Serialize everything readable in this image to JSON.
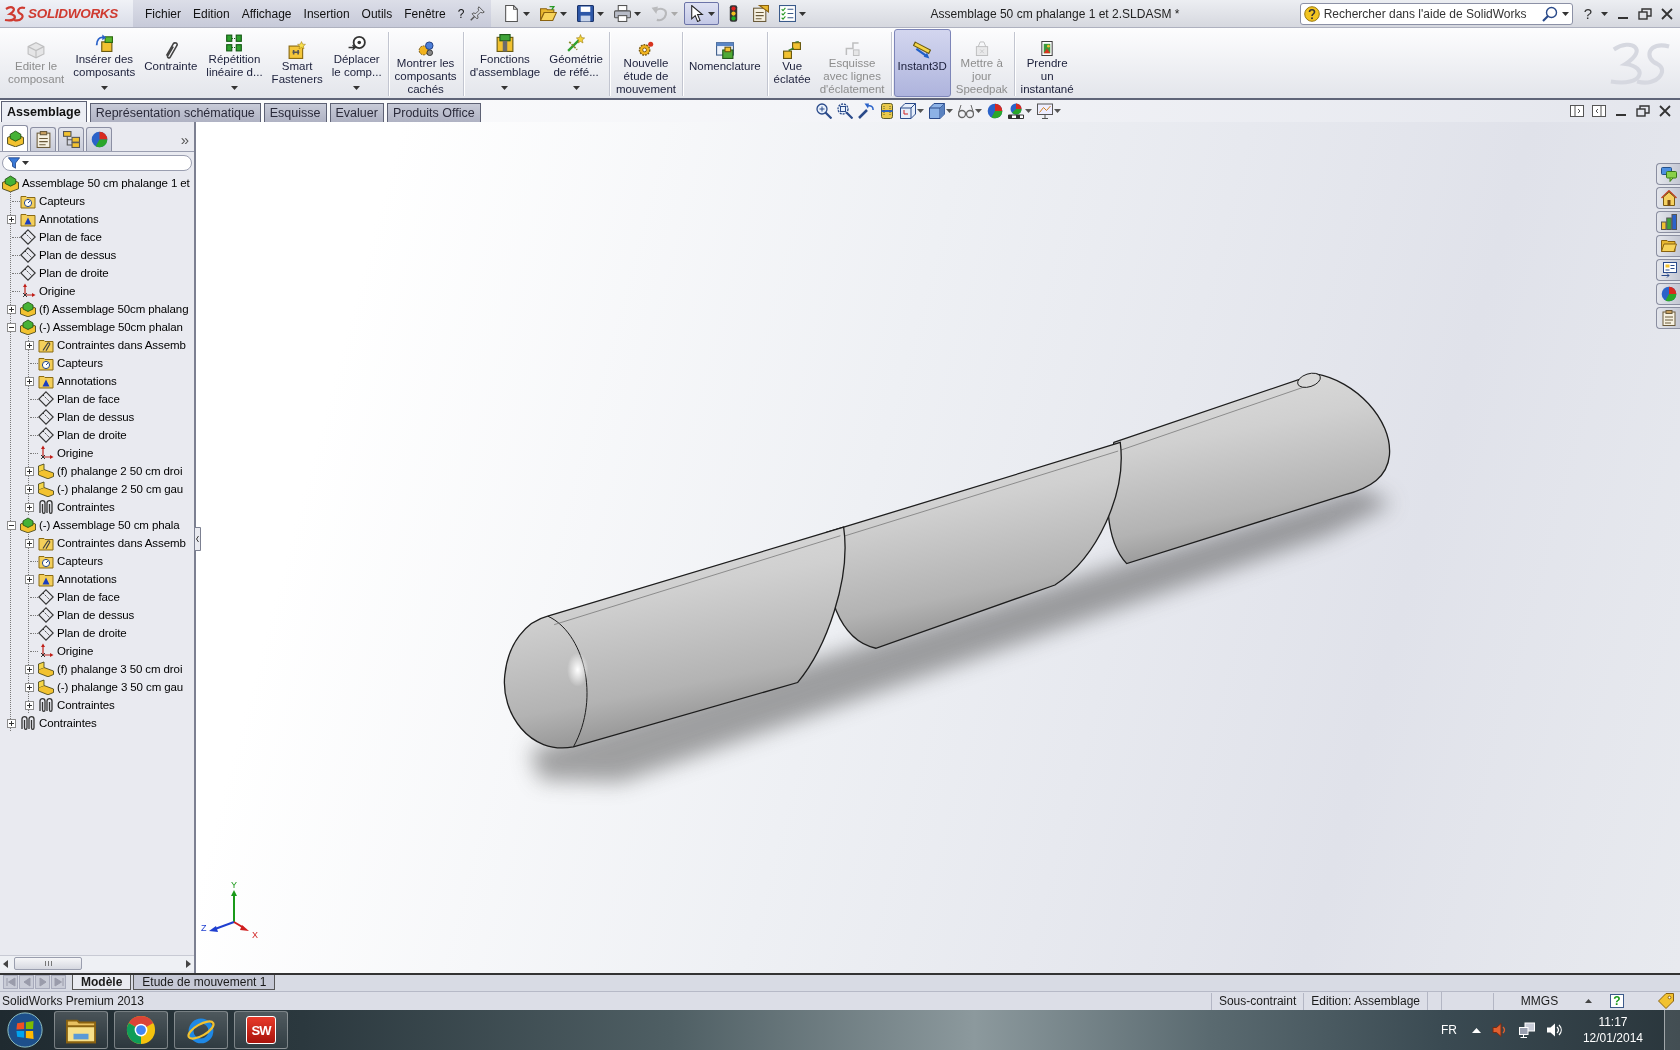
{
  "window": {
    "logo": "SOLIDWORKS",
    "title": "Assemblage 50 cm phalange 1 et 2.SLDASM *",
    "help_label": "?"
  },
  "menu": [
    "Fichier",
    "Edition",
    "Affichage",
    "Insertion",
    "Outils",
    "Fenêtre",
    "?"
  ],
  "quick_access": [
    {
      "kind": "new",
      "dropdown": true,
      "selected": false,
      "disabled": false
    },
    {
      "kind": "open",
      "dropdown": true,
      "selected": false,
      "disabled": false
    },
    {
      "kind": "save",
      "dropdown": true,
      "selected": false,
      "disabled": false
    },
    {
      "kind": "print",
      "dropdown": true,
      "selected": false,
      "disabled": false
    },
    {
      "kind": "undo",
      "dropdown": true,
      "selected": false,
      "disabled": true
    },
    {
      "kind": "select",
      "dropdown": true,
      "selected": true,
      "disabled": false
    },
    {
      "kind": "rebuild",
      "dropdown": false,
      "selected": false,
      "disabled": false
    },
    {
      "kind": "file-properties",
      "dropdown": false,
      "selected": false,
      "disabled": false
    },
    {
      "kind": "options",
      "dropdown": true,
      "selected": false,
      "disabled": false
    }
  ],
  "search": {
    "placeholder": "Rechercher dans l'aide de SolidWorks"
  },
  "command_manager": {
    "groups": [
      [
        {
          "kind": "edit-component",
          "label": "Editer le\ncomposant",
          "dropdown": false,
          "selected": false,
          "disabled": true
        },
        {
          "kind": "insert-components",
          "label": "Insérer des\ncomposants",
          "dropdown": true,
          "selected": false,
          "disabled": false
        },
        {
          "kind": "mate",
          "label": "Contrainte",
          "dropdown": false,
          "selected": false,
          "disabled": false
        },
        {
          "kind": "linear-pattern",
          "label": "Répétition\nlinéaire d...",
          "dropdown": true,
          "selected": false,
          "disabled": false
        },
        {
          "kind": "smart-fasteners",
          "label": "Smart\nFasteners",
          "dropdown": false,
          "selected": false,
          "disabled": false
        },
        {
          "kind": "move-component",
          "label": "Déplacer\nle comp...",
          "dropdown": true,
          "selected": false,
          "disabled": false
        }
      ],
      [
        {
          "kind": "show-hidden",
          "label": "Montrer les\ncomposants\ncachés",
          "dropdown": false,
          "selected": false,
          "disabled": false
        }
      ],
      [
        {
          "kind": "assembly-features",
          "label": "Fonctions\nd'assemblage",
          "dropdown": true,
          "selected": false,
          "disabled": false
        },
        {
          "kind": "reference-geometry",
          "label": "Géométrie\nde réfé...",
          "dropdown": true,
          "selected": false,
          "disabled": false
        }
      ],
      [
        {
          "kind": "motion-study",
          "label": "Nouvelle\nétude de\nmouvement",
          "dropdown": false,
          "selected": false,
          "disabled": false
        }
      ],
      [
        {
          "kind": "bom",
          "label": "Nomenclature",
          "dropdown": false,
          "selected": false,
          "disabled": false
        }
      ],
      [
        {
          "kind": "exploded-view",
          "label": "Vue\néclatée",
          "dropdown": false,
          "selected": false,
          "disabled": false
        },
        {
          "kind": "explode-line-sketch",
          "label": "Esquisse\navec lignes\nd'éclatement",
          "dropdown": false,
          "selected": false,
          "disabled": true
        }
      ],
      [
        {
          "kind": "instant3d",
          "label": "Instant3D",
          "dropdown": false,
          "selected": true,
          "disabled": false
        },
        {
          "kind": "speedpak",
          "label": "Mettre à\njour\nSpeedpak",
          "dropdown": false,
          "selected": false,
          "disabled": true
        }
      ],
      [
        {
          "kind": "snapshot",
          "label": "Prendre\nun\ninstantané",
          "dropdown": false,
          "selected": false,
          "disabled": false
        }
      ]
    ]
  },
  "tabs": [
    {
      "label": "Assemblage",
      "selected": true
    },
    {
      "label": "Représentation schématique",
      "selected": false
    },
    {
      "label": "Esquisse",
      "selected": false
    },
    {
      "label": "Evaluer",
      "selected": false
    },
    {
      "label": "Produits Office",
      "selected": false
    }
  ],
  "view_toolbar": [
    {
      "kind": "zoom-fit",
      "dropdown": false
    },
    {
      "kind": "zoom-area",
      "dropdown": false
    },
    {
      "kind": "previous-view",
      "dropdown": false
    },
    {
      "kind": "section-view",
      "dropdown": false
    },
    {
      "kind": "view-orientation",
      "dropdown": true
    },
    {
      "kind": "display-style",
      "dropdown": true
    },
    {
      "kind": "hide-show",
      "dropdown": true
    },
    {
      "kind": "appearance",
      "dropdown": false
    },
    {
      "kind": "scene",
      "dropdown": true
    },
    {
      "kind": "view-settings",
      "dropdown": true
    }
  ],
  "feature_manager": {
    "tabs": [
      {
        "kind": "feature-tree",
        "selected": true
      },
      {
        "kind": "property-manager",
        "selected": false
      },
      {
        "kind": "configuration-manager",
        "selected": false
      },
      {
        "kind": "display-manager",
        "selected": false
      }
    ],
    "more_label": "»",
    "tree": {
      "root": {
        "label": "Assemblage 50 cm phalange 1 et",
        "kind": "assembly"
      },
      "items": [
        {
          "label": "Capteurs",
          "kind": "sensors",
          "expandable": false
        },
        {
          "label": "Annotations",
          "kind": "annotations",
          "expandable": true,
          "expanded": false
        },
        {
          "label": "Plan de face",
          "kind": "plane",
          "expandable": false
        },
        {
          "label": "Plan de dessus",
          "kind": "plane",
          "expandable": false
        },
        {
          "label": "Plan de droite",
          "kind": "plane",
          "expandable": false
        },
        {
          "label": "Origine",
          "kind": "origin",
          "expandable": false
        },
        {
          "label": "(f) Assemblage 50cm phalang",
          "kind": "assembly",
          "expandable": true,
          "expanded": false
        },
        {
          "label": "(-) Assemblage 50cm phalan",
          "kind": "assembly",
          "expandable": true,
          "expanded": true,
          "children": [
            {
              "label": "Contraintes dans Assemb",
              "kind": "mates-folder",
              "expandable": true,
              "expanded": false
            },
            {
              "label": "Capteurs",
              "kind": "sensors",
              "expandable": false
            },
            {
              "label": "Annotations",
              "kind": "annotations",
              "expandable": true,
              "expanded": false
            },
            {
              "label": "Plan de face",
              "kind": "plane",
              "expandable": false
            },
            {
              "label": "Plan de dessus",
              "kind": "plane",
              "expandable": false
            },
            {
              "label": "Plan de droite",
              "kind": "plane",
              "expandable": false
            },
            {
              "label": "Origine",
              "kind": "origin",
              "expandable": false
            },
            {
              "label": "(f) phalange 2 50 cm droi",
              "kind": "part",
              "expandable": true,
              "expanded": false
            },
            {
              "label": "(-) phalange 2 50 cm gau",
              "kind": "part",
              "expandable": true,
              "expanded": false
            },
            {
              "label": "Contraintes",
              "kind": "mates",
              "expandable": true,
              "expanded": false
            }
          ]
        },
        {
          "label": "(-) Assemblage 50 cm phala",
          "kind": "assembly",
          "expandable": true,
          "expanded": true,
          "children": [
            {
              "label": "Contraintes dans Assemb",
              "kind": "mates-folder",
              "expandable": true,
              "expanded": false
            },
            {
              "label": "Capteurs",
              "kind": "sensors",
              "expandable": false
            },
            {
              "label": "Annotations",
              "kind": "annotations",
              "expandable": true,
              "expanded": false
            },
            {
              "label": "Plan de face",
              "kind": "plane",
              "expandable": false
            },
            {
              "label": "Plan de dessus",
              "kind": "plane",
              "expandable": false
            },
            {
              "label": "Plan de droite",
              "kind": "plane",
              "expandable": false
            },
            {
              "label": "Origine",
              "kind": "origin",
              "expandable": false
            },
            {
              "label": "(f) phalange 3 50 cm droi",
              "kind": "part",
              "expandable": true,
              "expanded": false
            },
            {
              "label": "(-) phalange 3 50 cm gau",
              "kind": "part",
              "expandable": true,
              "expanded": false
            },
            {
              "label": "Contraintes",
              "kind": "mates",
              "expandable": true,
              "expanded": false
            }
          ]
        },
        {
          "label": "Contraintes",
          "kind": "mates",
          "expandable": true,
          "expanded": false
        }
      ]
    }
  },
  "viewport": {
    "triad": {
      "x_label": "X",
      "y_label": "Y",
      "z_label": "Z"
    }
  },
  "bottom_bar": {
    "nav_disabled": true,
    "tabs": [
      {
        "label": "Modèle",
        "selected": true
      },
      {
        "label": "Etude de mouvement 1",
        "selected": false
      }
    ]
  },
  "status_bar": {
    "product": "SolidWorks Premium 2013",
    "fields": [
      "Sous-contraint",
      "Edition: Assemblage",
      "MMGS"
    ],
    "help_label": "?"
  },
  "taskbar": {
    "pinned": [
      {
        "kind": "explorer"
      },
      {
        "kind": "chrome"
      },
      {
        "kind": "ie"
      },
      {
        "kind": "solidworks",
        "text": "SW"
      }
    ],
    "language": "FR",
    "time": "11:17",
    "date": "12/01/2014"
  }
}
